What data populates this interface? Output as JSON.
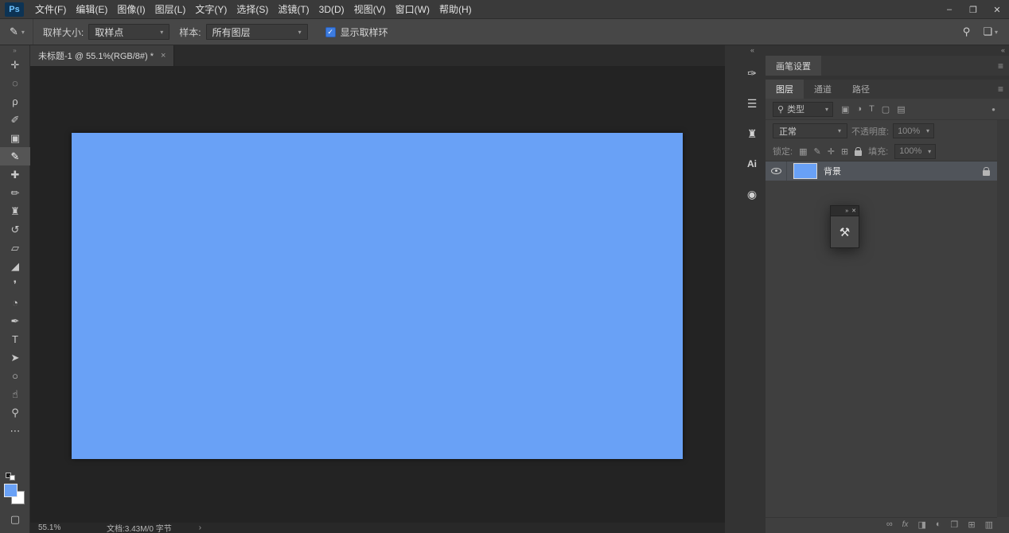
{
  "window": {
    "minimize": "–",
    "restore": "❐",
    "close": "✕"
  },
  "menu": {
    "logo": "Ps",
    "items": [
      "文件(F)",
      "编辑(E)",
      "图像(I)",
      "图层(L)",
      "文字(Y)",
      "选择(S)",
      "滤镜(T)",
      "3D(D)",
      "视图(V)",
      "窗口(W)",
      "帮助(H)"
    ]
  },
  "options": {
    "tool_glyph": "✎",
    "dd_arrow": "▾",
    "sample_size_label": "取样大小:",
    "sample_size_value": "取样点",
    "sample_label": "样本:",
    "sample_value": "所有图层",
    "check_glyph": "✓",
    "show_ring_label": "显示取样环",
    "show_ring_checked": true,
    "search_glyph": "⚲",
    "workspace_glyph": "❏"
  },
  "toolbar": {
    "collapse_glyph": "»",
    "tools": [
      {
        "name": "move-tool",
        "glyph": "✛"
      },
      {
        "name": "marquee-tool",
        "glyph": "◌"
      },
      {
        "name": "lasso-tool",
        "glyph": "ρ"
      },
      {
        "name": "quick-selection-tool",
        "glyph": "✐"
      },
      {
        "name": "crop-tool",
        "glyph": "▣"
      },
      {
        "name": "eyedropper-tool",
        "glyph": "✎",
        "selected": true
      },
      {
        "name": "healing-brush-tool",
        "glyph": "✚"
      },
      {
        "name": "brush-tool",
        "glyph": "✏"
      },
      {
        "name": "clone-stamp-tool",
        "glyph": "♜"
      },
      {
        "name": "history-brush-tool",
        "glyph": "↺"
      },
      {
        "name": "eraser-tool",
        "glyph": "▱"
      },
      {
        "name": "gradient-tool",
        "glyph": "◢"
      },
      {
        "name": "blur-tool",
        "glyph": "❜"
      },
      {
        "name": "dodge-tool",
        "glyph": "◔"
      },
      {
        "name": "pen-tool",
        "glyph": "✒"
      },
      {
        "name": "type-tool",
        "glyph": "T"
      },
      {
        "name": "path-selection-tool",
        "glyph": "➤"
      },
      {
        "name": "shape-tool",
        "glyph": "○"
      },
      {
        "name": "hand-tool",
        "glyph": "☝"
      },
      {
        "name": "zoom-tool",
        "glyph": "⚲"
      },
      {
        "name": "edit-toolbar",
        "glyph": "⋯"
      }
    ],
    "foreground_color": "#69a1f6",
    "background_color": "#ffffff",
    "screen_mode_glyph": "▢"
  },
  "document_tab": {
    "title": "未标题-1 @ 55.1%(RGB/8#) *",
    "close_glyph": "×"
  },
  "canvas": {
    "color": "#69a1f6"
  },
  "dock": {
    "collapse_glyph": "«",
    "collapsed_icons": [
      {
        "name": "brush-settings",
        "glyph": "✑"
      },
      {
        "name": "properties",
        "glyph": "☰"
      },
      {
        "name": "clone-source",
        "glyph": "♜"
      },
      {
        "name": "ai",
        "glyph": "Ai"
      },
      {
        "name": "libraries",
        "glyph": "◉"
      }
    ],
    "brush_settings": {
      "tab": "画笔设置",
      "menu_glyph": "≡"
    },
    "layers_panel": {
      "tabs": [
        "图层",
        "通道",
        "路径"
      ],
      "menu_glyph": "≡",
      "filter": {
        "search_glyph": "⚲",
        "label": "类型",
        "arrow": "▾",
        "icons": [
          {
            "name": "pixel-layers-filter",
            "glyph": "▣"
          },
          {
            "name": "adjustment-layers-filter",
            "glyph": "◑"
          },
          {
            "name": "type-layers-filter",
            "glyph": "T"
          },
          {
            "name": "shape-layers-filter",
            "glyph": "▢"
          },
          {
            "name": "smart-object-filter",
            "glyph": "▤"
          }
        ],
        "toggle_glyph": "●"
      },
      "blend_mode": "正常",
      "opacity_label": "不透明度:",
      "opacity_value": "100%",
      "lock_label": "锁定:",
      "lock_icons": [
        {
          "name": "lock-transparency",
          "glyph": "▦"
        },
        {
          "name": "lock-pixels",
          "glyph": "✎"
        },
        {
          "name": "lock-position",
          "glyph": "✛"
        },
        {
          "name": "lock-artboard",
          "glyph": "⊞"
        }
      ],
      "fill_label": "填充:",
      "fill_value": "100%",
      "layer": {
        "name": "背景",
        "thumb_color": "#69a1f6",
        "locked": true,
        "visible": true
      },
      "bottom_icons": [
        {
          "name": "link-layers",
          "glyph": "∞"
        },
        {
          "name": "layer-style",
          "glyph": "fx"
        },
        {
          "name": "add-layer-mask",
          "glyph": "◨"
        },
        {
          "name": "new-adjustment-layer",
          "glyph": "◐"
        },
        {
          "name": "new-group",
          "glyph": "❐"
        },
        {
          "name": "new-layer",
          "glyph": "⊞"
        },
        {
          "name": "delete-layer",
          "glyph": "▥"
        }
      ]
    }
  },
  "flyout": {
    "collapse_glyph": "»",
    "close_glyph": "✕",
    "icon_glyph": "⚒"
  },
  "status": {
    "zoom": "55.1%",
    "doc_info": "文档:3.43M/0 字节",
    "chevron": "›"
  }
}
